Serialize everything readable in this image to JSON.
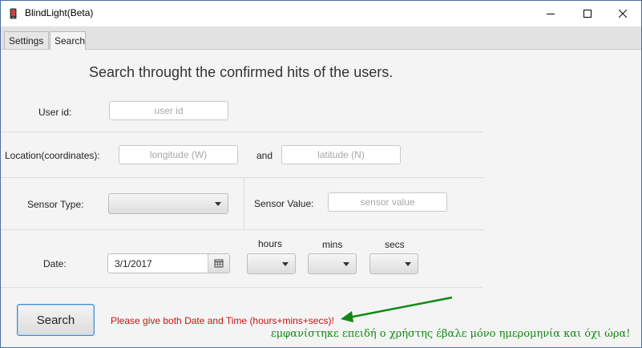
{
  "window": {
    "title": "BlindLight(Beta)"
  },
  "tabs": [
    {
      "label": "Settings"
    },
    {
      "label": "Search"
    }
  ],
  "search_form": {
    "heading": "Search throught the confirmed hits of the users.",
    "user_id_label": "User id:",
    "user_id_placeholder": "user id",
    "location_label": "Location(coordinates):",
    "longitude_placeholder": "longitude (W)",
    "and_label": "and",
    "latitude_placeholder": "latitude (N)",
    "sensor_type_label": "Sensor Type:",
    "sensor_value_label": "Sensor Value:",
    "sensor_value_placeholder": "sensor value",
    "date_label": "Date:",
    "date_value": "3/1/2017",
    "hours_label": "hours",
    "mins_label": "mins",
    "secs_label": "secs",
    "search_button": "Search",
    "error_message": "Please give both Date and Time (hours+mins+secs)!"
  },
  "annotation": {
    "note": "εμφανίστηκε επειδή ο χρήστης έβαλε μόνο ημερομηνία και όχι ώρα!",
    "color": "#118811"
  },
  "colors": {
    "error": "#cc1111",
    "focus_border": "#3f8fd2"
  }
}
